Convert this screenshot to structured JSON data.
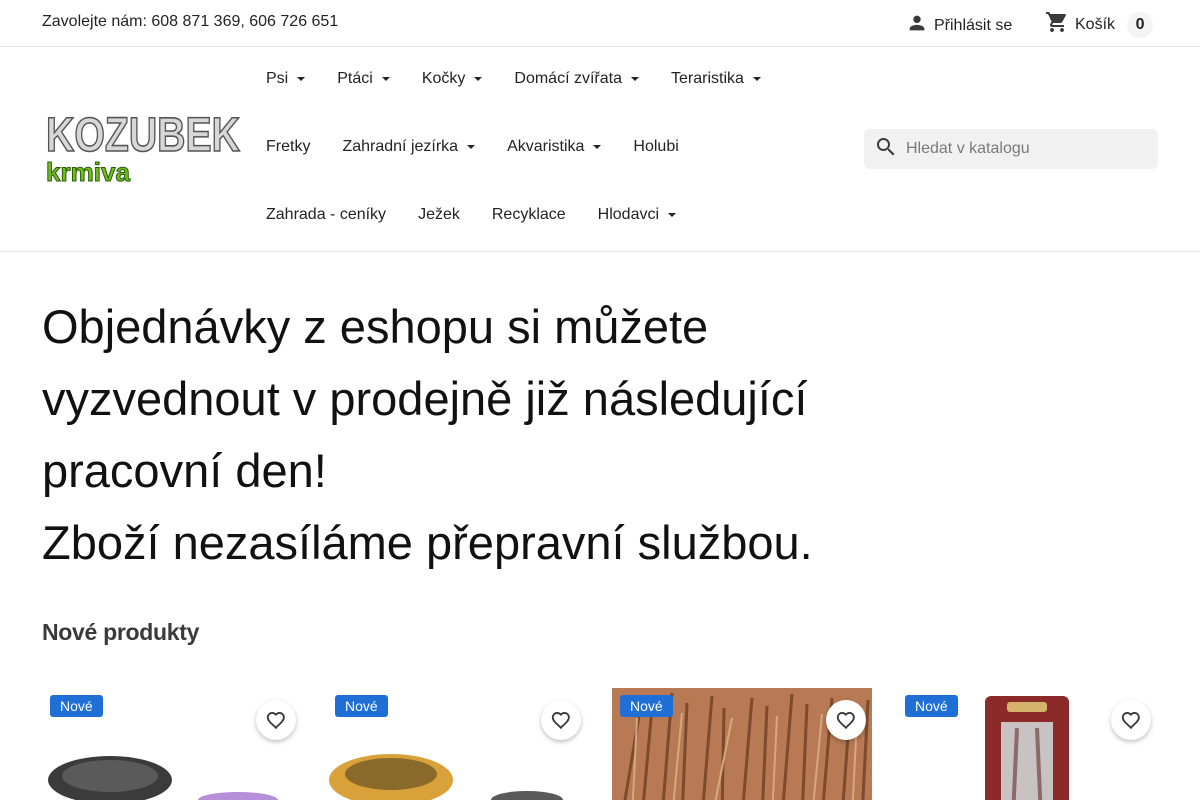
{
  "topbar": {
    "phone": "Zavolejte nám: 608 871 369, 606 726 651",
    "login": "Přihlásit se",
    "cart_label": "Košík",
    "cart_count": "0"
  },
  "logo": {
    "line1": "KOZUBEK",
    "line2": "krmiva"
  },
  "nav": {
    "row1": [
      {
        "label": "Psi",
        "dropdown": true
      },
      {
        "label": "Ptáci",
        "dropdown": true
      },
      {
        "label": "Kočky",
        "dropdown": true
      },
      {
        "label": "Domácí zvířata",
        "dropdown": true
      },
      {
        "label": "Teraristika",
        "dropdown": true
      }
    ],
    "row2": [
      {
        "label": "Fretky",
        "dropdown": false
      },
      {
        "label": "Zahradní jezírka",
        "dropdown": true
      },
      {
        "label": "Akvaristika",
        "dropdown": true
      },
      {
        "label": "Holubi",
        "dropdown": false
      }
    ],
    "row3": [
      {
        "label": "Zahrada - ceníky",
        "dropdown": false
      },
      {
        "label": "Ježek",
        "dropdown": false
      },
      {
        "label": "Recyklace",
        "dropdown": false
      },
      {
        "label": "Hlodavci",
        "dropdown": true
      }
    ]
  },
  "search": {
    "placeholder": "Hledat v katalogu"
  },
  "hero": {
    "line1": "Objednávky z eshopu si můžete",
    "line2": "vyzvednout v prodejně již následující",
    "line3": "pracovní den!",
    "line4": "Zboží nezasíláme přepravní službou."
  },
  "new_products": {
    "title": "Nové produkty",
    "items": [
      {
        "badge": "Nové"
      },
      {
        "badge": "Nové"
      },
      {
        "badge": "Nové"
      },
      {
        "badge": "Nové"
      }
    ]
  },
  "colors": {
    "badge": "#1f6fd6",
    "logo_green": "#6fbf1f",
    "search_bg": "#f1f1f1"
  }
}
